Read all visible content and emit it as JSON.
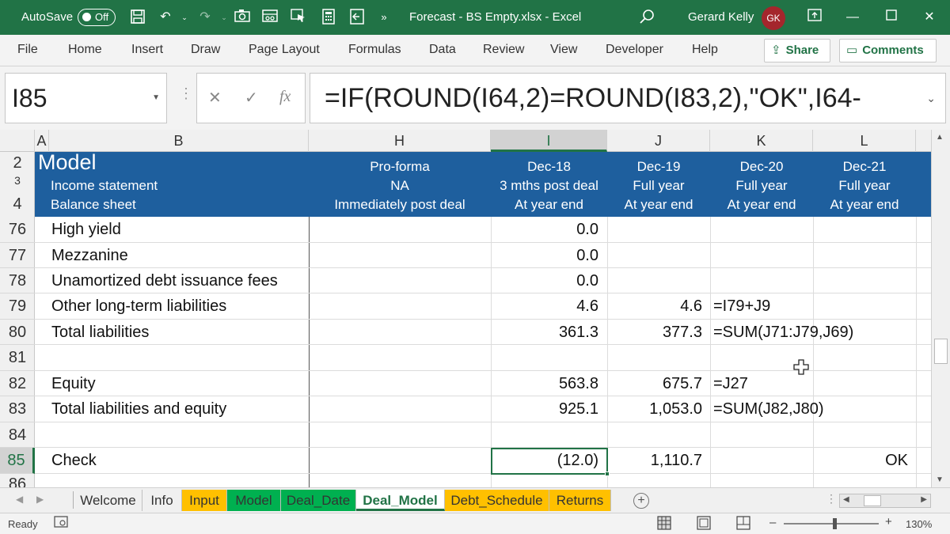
{
  "titlebar": {
    "autosave_label": "AutoSave",
    "autosave_state": "Off",
    "document_title": "Forecast - BS Empty.xlsx  -  Excel",
    "user_name": "Gerard Kelly",
    "user_initials": "GK"
  },
  "ribbon": {
    "tabs": [
      "File",
      "Home",
      "Insert",
      "Draw",
      "Page Layout",
      "Formulas",
      "Data",
      "Review",
      "View",
      "Developer",
      "Help"
    ],
    "share_label": "Share",
    "comments_label": "Comments"
  },
  "formula_bar": {
    "name_box": "I85",
    "formula": "=IF(ROUND(I64,2)=ROUND(I83,2),\"OK\",I64-"
  },
  "columns": [
    "A",
    "B",
    "H",
    "I",
    "J",
    "K",
    "L"
  ],
  "header_band": {
    "row_numbers": [
      "2",
      "3",
      "4"
    ],
    "title": "Model",
    "subtitle1": "Income statement",
    "subtitle2": "Balance sheet",
    "H": [
      "Pro-forma",
      "NA",
      "Immediately post deal"
    ],
    "I": [
      "Dec-18",
      "3 mths post deal",
      "At year end"
    ],
    "J": [
      "Dec-19",
      "Full year",
      "At year end"
    ],
    "K": [
      "Dec-20",
      "Full year",
      "At year end"
    ],
    "L": [
      "Dec-21",
      "Full year",
      "At year end"
    ]
  },
  "rows": [
    {
      "num": "76",
      "B": "High yield",
      "I": "0.0",
      "J": "",
      "K": "",
      "L": ""
    },
    {
      "num": "77",
      "B": "Mezzanine",
      "I": "0.0",
      "J": "",
      "K": "",
      "L": ""
    },
    {
      "num": "78",
      "B": "Unamortized debt issuance fees",
      "I": "0.0",
      "J": "",
      "K": "",
      "L": ""
    },
    {
      "num": "79",
      "B": "Other long-term liabilities",
      "I": "4.6",
      "J": "4.6",
      "K": "=I79+J9",
      "L": ""
    },
    {
      "num": "80",
      "B": "Total liabilities",
      "I": "361.3",
      "J": "377.3",
      "K": "=SUM(J71:J79,J69)",
      "L": ""
    },
    {
      "num": "81",
      "B": "",
      "I": "",
      "J": "",
      "K": "",
      "L": ""
    },
    {
      "num": "82",
      "B": "Equity",
      "I": "563.8",
      "J": "675.7",
      "K": "=J27",
      "L": ""
    },
    {
      "num": "83",
      "B": "Total liabilities and equity",
      "I": "925.1",
      "J": "1,053.0",
      "K": "=SUM(J82,J80)",
      "L": ""
    },
    {
      "num": "84",
      "B": "",
      "I": "",
      "J": "",
      "K": "",
      "L": ""
    },
    {
      "num": "85",
      "B": "Check",
      "I": "(12.0)",
      "J": "1,110.7",
      "K": "",
      "L": "OK"
    },
    {
      "num": "86",
      "B": "",
      "I": "",
      "J": "",
      "K": "",
      "L": ""
    }
  ],
  "sheet_tabs": [
    {
      "label": "Welcome",
      "color": "#f0f0f0"
    },
    {
      "label": "Info",
      "color": "#f0f0f0"
    },
    {
      "label": "Input",
      "color": "#ffc000"
    },
    {
      "label": "Model",
      "color": "#00b050"
    },
    {
      "label": "Deal_Date",
      "color": "#00b050"
    },
    {
      "label": "Deal_Model",
      "color": "#ffffff"
    },
    {
      "label": "Debt_Schedule",
      "color": "#ffc000"
    },
    {
      "label": "Returns",
      "color": "#ffc000"
    }
  ],
  "status": {
    "ready": "Ready",
    "zoom_minus": "–",
    "zoom_plus": "+",
    "zoom": "130%"
  },
  "colors": {
    "excel_green": "#217346",
    "header_band": "#1e5f9e",
    "avatar": "#a4262c"
  }
}
